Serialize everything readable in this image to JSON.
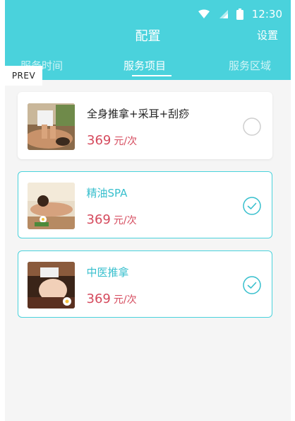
{
  "status_bar": {
    "time": "12:30",
    "icons": [
      "wifi-icon",
      "signal-icon",
      "battery-icon"
    ]
  },
  "header": {
    "title": "配置",
    "settings_label": "设置"
  },
  "tabs": [
    {
      "label": "服务时间",
      "active": false
    },
    {
      "label": "服务项目",
      "active": true
    },
    {
      "label": "服务区域",
      "active": false
    }
  ],
  "prev_label": "PREV",
  "services": [
    {
      "name": "全身推拿+采耳+刮痧",
      "price": "369",
      "unit": "元/次",
      "selected": false,
      "image": "massage-back-photo"
    },
    {
      "name": "精油SPA",
      "price": "369",
      "unit": "元/次",
      "selected": true,
      "image": "spa-photo"
    },
    {
      "name": "中医推拿",
      "price": "369",
      "unit": "元/次",
      "selected": true,
      "image": "facial-massage-photo"
    }
  ],
  "colors": {
    "accent": "#4ad2dc",
    "price": "#d54a5d",
    "selected_text": "#37bfcd"
  }
}
